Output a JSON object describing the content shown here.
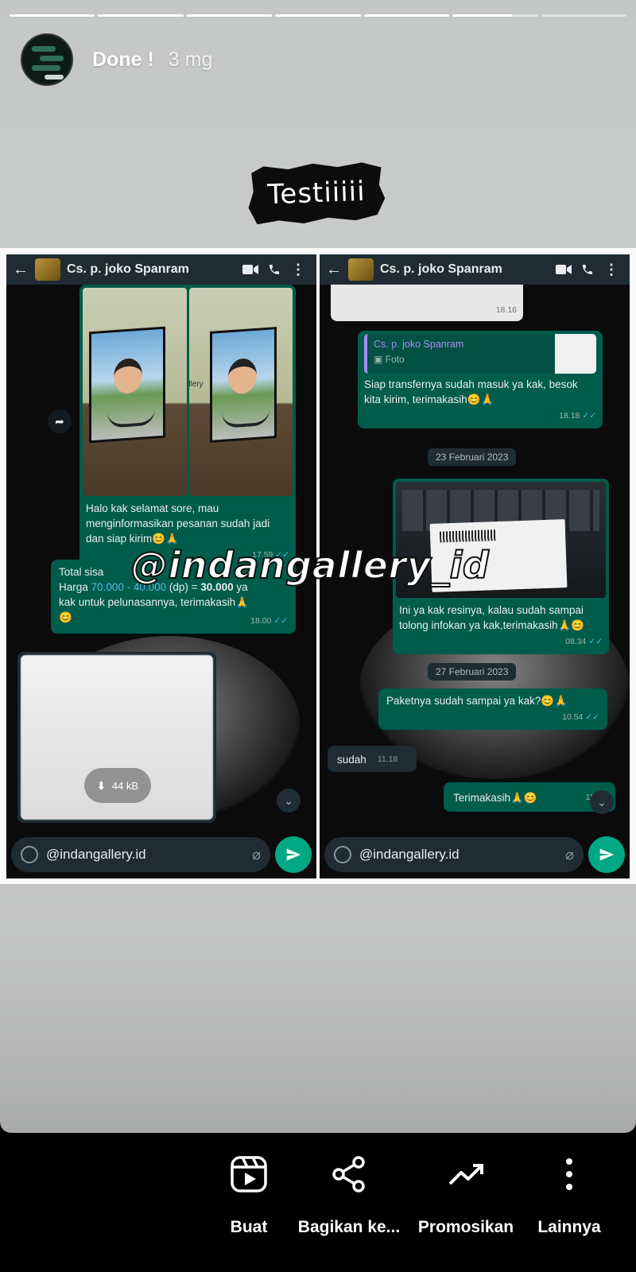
{
  "story": {
    "progress_segments": [
      1,
      1,
      1,
      1,
      1,
      0.7,
      0
    ],
    "username": "Done !",
    "time_ago": "3 mg",
    "caption": "Testiiiii",
    "watermark": "@indangallery_id"
  },
  "chat_left": {
    "contact_name": "Cs. p. joko Spanram",
    "msg1_text": "Halo kak selamat sore, mau menginformasikan pesanan sudah jadi dan siap kirim😊🙏",
    "msg1_time": "17.59",
    "photo_watermark": "@indangallery",
    "msg2_line1": "Total sisa",
    "msg2_harga_label": "Harga",
    "msg2_price_a": "70.000",
    "msg2_price_sep": " - ",
    "msg2_price_b": "40.000",
    "msg2_dp": " (dp) = ",
    "msg2_total": "30.000",
    "msg2_ya": " ya",
    "msg2_line3": "kak untuk pelunasannya, terimakasih🙏",
    "msg2_emoji": "😊",
    "msg2_time": "18.00",
    "download_size": "44 kB",
    "composer_text": "@indangallery.id"
  },
  "chat_right": {
    "contact_name": "Cs. p. joko Spanram",
    "msg0_time": "18.16",
    "reply_name": "Cs. p. joko Spanram",
    "reply_type": "Foto",
    "msg1_text": "Siap transfernya sudah masuk ya kak, besok kita kirim, terimakasih😊🙏",
    "msg1_time": "18.18",
    "date1": "23 Februari 2023",
    "msg2_text": "Ini ya kak resinya, kalau sudah sampai tolong infokan ya kak,terimakasih🙏😊",
    "msg2_time": "08.34",
    "date2": "27 Februari 2023",
    "msg3_text": "Paketnya sudah sampai ya kak?😊🙏",
    "msg3_time": "10.54",
    "msg4_text": "sudah",
    "msg4_time": "11.18",
    "msg5_text": "Terimakasih🙏😊",
    "msg5_time": "11.18",
    "composer_text": "@indangallery.id"
  },
  "actions": [
    {
      "label": "Buat",
      "icon": "reels-icon"
    },
    {
      "label": "Bagikan ke...",
      "icon": "share-icon"
    },
    {
      "label": "Promosikan",
      "icon": "trending-up-icon"
    },
    {
      "label": "Lainnya",
      "icon": "more-vertical-icon"
    }
  ],
  "colors": {
    "wa_out_bubble": "#005c4b",
    "wa_in_bubble": "#1f2c33",
    "wa_send": "#00a884",
    "tick_blue": "#53bdeb"
  }
}
